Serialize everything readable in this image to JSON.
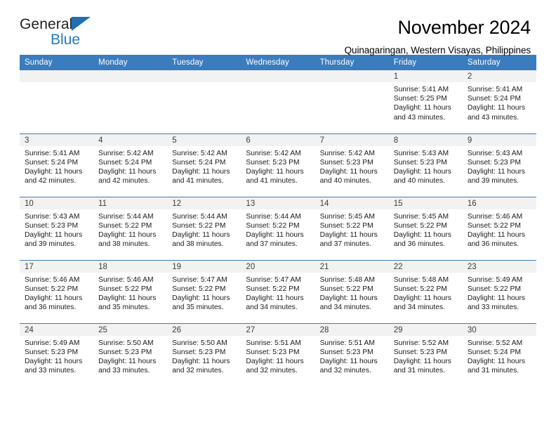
{
  "brand": {
    "name_part1": "General",
    "name_part2": "Blue",
    "triangle_color": "#1f6fb5",
    "blue_text_color": "#1f7ac4"
  },
  "header": {
    "title": "November 2024",
    "subtitle": "Quinagaringan, Western Visayas, Philippines"
  },
  "theme": {
    "header_row_bg": "#3a7cbe",
    "daynum_band_bg": "#f2f2f2",
    "row_divider": "#3a7cbe"
  },
  "weekdays": [
    "Sunday",
    "Monday",
    "Tuesday",
    "Wednesday",
    "Thursday",
    "Friday",
    "Saturday"
  ],
  "weeks": [
    [
      {
        "day": "",
        "empty": true
      },
      {
        "day": "",
        "empty": true
      },
      {
        "day": "",
        "empty": true
      },
      {
        "day": "",
        "empty": true
      },
      {
        "day": "",
        "empty": true
      },
      {
        "day": "1",
        "sunrise": "Sunrise: 5:41 AM",
        "sunset": "Sunset: 5:25 PM",
        "daylight_line1": "Daylight: 11 hours",
        "daylight_line2": "and 43 minutes."
      },
      {
        "day": "2",
        "sunrise": "Sunrise: 5:41 AM",
        "sunset": "Sunset: 5:24 PM",
        "daylight_line1": "Daylight: 11 hours",
        "daylight_line2": "and 43 minutes."
      }
    ],
    [
      {
        "day": "3",
        "sunrise": "Sunrise: 5:41 AM",
        "sunset": "Sunset: 5:24 PM",
        "daylight_line1": "Daylight: 11 hours",
        "daylight_line2": "and 42 minutes."
      },
      {
        "day": "4",
        "sunrise": "Sunrise: 5:42 AM",
        "sunset": "Sunset: 5:24 PM",
        "daylight_line1": "Daylight: 11 hours",
        "daylight_line2": "and 42 minutes."
      },
      {
        "day": "5",
        "sunrise": "Sunrise: 5:42 AM",
        "sunset": "Sunset: 5:24 PM",
        "daylight_line1": "Daylight: 11 hours",
        "daylight_line2": "and 41 minutes."
      },
      {
        "day": "6",
        "sunrise": "Sunrise: 5:42 AM",
        "sunset": "Sunset: 5:23 PM",
        "daylight_line1": "Daylight: 11 hours",
        "daylight_line2": "and 41 minutes."
      },
      {
        "day": "7",
        "sunrise": "Sunrise: 5:42 AM",
        "sunset": "Sunset: 5:23 PM",
        "daylight_line1": "Daylight: 11 hours",
        "daylight_line2": "and 40 minutes."
      },
      {
        "day": "8",
        "sunrise": "Sunrise: 5:43 AM",
        "sunset": "Sunset: 5:23 PM",
        "daylight_line1": "Daylight: 11 hours",
        "daylight_line2": "and 40 minutes."
      },
      {
        "day": "9",
        "sunrise": "Sunrise: 5:43 AM",
        "sunset": "Sunset: 5:23 PM",
        "daylight_line1": "Daylight: 11 hours",
        "daylight_line2": "and 39 minutes."
      }
    ],
    [
      {
        "day": "10",
        "sunrise": "Sunrise: 5:43 AM",
        "sunset": "Sunset: 5:23 PM",
        "daylight_line1": "Daylight: 11 hours",
        "daylight_line2": "and 39 minutes."
      },
      {
        "day": "11",
        "sunrise": "Sunrise: 5:44 AM",
        "sunset": "Sunset: 5:22 PM",
        "daylight_line1": "Daylight: 11 hours",
        "daylight_line2": "and 38 minutes."
      },
      {
        "day": "12",
        "sunrise": "Sunrise: 5:44 AM",
        "sunset": "Sunset: 5:22 PM",
        "daylight_line1": "Daylight: 11 hours",
        "daylight_line2": "and 38 minutes."
      },
      {
        "day": "13",
        "sunrise": "Sunrise: 5:44 AM",
        "sunset": "Sunset: 5:22 PM",
        "daylight_line1": "Daylight: 11 hours",
        "daylight_line2": "and 37 minutes."
      },
      {
        "day": "14",
        "sunrise": "Sunrise: 5:45 AM",
        "sunset": "Sunset: 5:22 PM",
        "daylight_line1": "Daylight: 11 hours",
        "daylight_line2": "and 37 minutes."
      },
      {
        "day": "15",
        "sunrise": "Sunrise: 5:45 AM",
        "sunset": "Sunset: 5:22 PM",
        "daylight_line1": "Daylight: 11 hours",
        "daylight_line2": "and 36 minutes."
      },
      {
        "day": "16",
        "sunrise": "Sunrise: 5:46 AM",
        "sunset": "Sunset: 5:22 PM",
        "daylight_line1": "Daylight: 11 hours",
        "daylight_line2": "and 36 minutes."
      }
    ],
    [
      {
        "day": "17",
        "sunrise": "Sunrise: 5:46 AM",
        "sunset": "Sunset: 5:22 PM",
        "daylight_line1": "Daylight: 11 hours",
        "daylight_line2": "and 36 minutes."
      },
      {
        "day": "18",
        "sunrise": "Sunrise: 5:46 AM",
        "sunset": "Sunset: 5:22 PM",
        "daylight_line1": "Daylight: 11 hours",
        "daylight_line2": "and 35 minutes."
      },
      {
        "day": "19",
        "sunrise": "Sunrise: 5:47 AM",
        "sunset": "Sunset: 5:22 PM",
        "daylight_line1": "Daylight: 11 hours",
        "daylight_line2": "and 35 minutes."
      },
      {
        "day": "20",
        "sunrise": "Sunrise: 5:47 AM",
        "sunset": "Sunset: 5:22 PM",
        "daylight_line1": "Daylight: 11 hours",
        "daylight_line2": "and 34 minutes."
      },
      {
        "day": "21",
        "sunrise": "Sunrise: 5:48 AM",
        "sunset": "Sunset: 5:22 PM",
        "daylight_line1": "Daylight: 11 hours",
        "daylight_line2": "and 34 minutes."
      },
      {
        "day": "22",
        "sunrise": "Sunrise: 5:48 AM",
        "sunset": "Sunset: 5:22 PM",
        "daylight_line1": "Daylight: 11 hours",
        "daylight_line2": "and 34 minutes."
      },
      {
        "day": "23",
        "sunrise": "Sunrise: 5:49 AM",
        "sunset": "Sunset: 5:22 PM",
        "daylight_line1": "Daylight: 11 hours",
        "daylight_line2": "and 33 minutes."
      }
    ],
    [
      {
        "day": "24",
        "sunrise": "Sunrise: 5:49 AM",
        "sunset": "Sunset: 5:23 PM",
        "daylight_line1": "Daylight: 11 hours",
        "daylight_line2": "and 33 minutes."
      },
      {
        "day": "25",
        "sunrise": "Sunrise: 5:50 AM",
        "sunset": "Sunset: 5:23 PM",
        "daylight_line1": "Daylight: 11 hours",
        "daylight_line2": "and 33 minutes."
      },
      {
        "day": "26",
        "sunrise": "Sunrise: 5:50 AM",
        "sunset": "Sunset: 5:23 PM",
        "daylight_line1": "Daylight: 11 hours",
        "daylight_line2": "and 32 minutes."
      },
      {
        "day": "27",
        "sunrise": "Sunrise: 5:51 AM",
        "sunset": "Sunset: 5:23 PM",
        "daylight_line1": "Daylight: 11 hours",
        "daylight_line2": "and 32 minutes."
      },
      {
        "day": "28",
        "sunrise": "Sunrise: 5:51 AM",
        "sunset": "Sunset: 5:23 PM",
        "daylight_line1": "Daylight: 11 hours",
        "daylight_line2": "and 32 minutes."
      },
      {
        "day": "29",
        "sunrise": "Sunrise: 5:52 AM",
        "sunset": "Sunset: 5:23 PM",
        "daylight_line1": "Daylight: 11 hours",
        "daylight_line2": "and 31 minutes."
      },
      {
        "day": "30",
        "sunrise": "Sunrise: 5:52 AM",
        "sunset": "Sunset: 5:24 PM",
        "daylight_line1": "Daylight: 11 hours",
        "daylight_line2": "and 31 minutes."
      }
    ]
  ]
}
